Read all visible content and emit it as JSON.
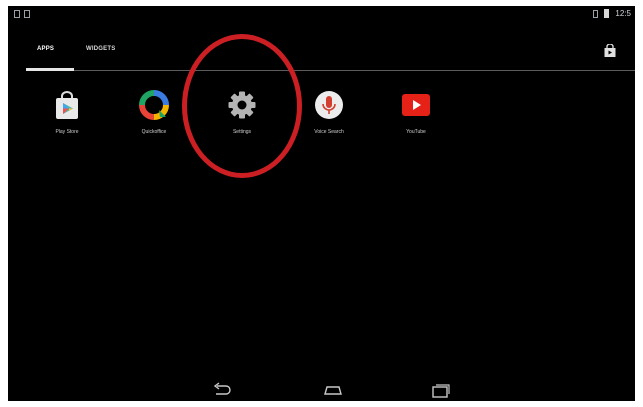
{
  "status_bar": {
    "time": "12:5"
  },
  "tabs": [
    {
      "label": "APPS",
      "selected": true
    },
    {
      "label": "WIDGETS",
      "selected": false
    }
  ],
  "apps": [
    {
      "label": "Play Store",
      "icon": "play-store-icon"
    },
    {
      "label": "Quickoffice",
      "icon": "quickoffice-icon"
    },
    {
      "label": "Settings",
      "icon": "settings-gear-icon"
    },
    {
      "label": "Voice Search",
      "icon": "microphone-icon"
    },
    {
      "label": "YouTube",
      "icon": "youtube-icon"
    }
  ],
  "colors": {
    "background": "#000000",
    "highlight_circle": "#cc1f24",
    "youtube_red": "#e62117",
    "voice_red": "#d23f31"
  }
}
